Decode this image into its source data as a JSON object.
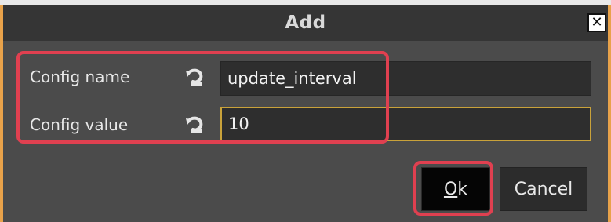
{
  "dialog": {
    "title": "Add",
    "close_icon": "close-icon"
  },
  "form": {
    "config_name_label": "Config name",
    "config_name_value": "update_interval",
    "config_value_label": "Config value",
    "config_value_value": "10",
    "reset_icon": "reset-icon"
  },
  "buttons": {
    "ok_label": "Ok",
    "ok_mnemonic": "O",
    "ok_rest": "k",
    "cancel_label": "Cancel"
  },
  "colors": {
    "dialog_bg": "#4b4b4b",
    "titlebar_bg": "#353535",
    "border_accent": "#e8a24a",
    "highlight": "#e04050",
    "focus_border": "#c9a23a"
  }
}
